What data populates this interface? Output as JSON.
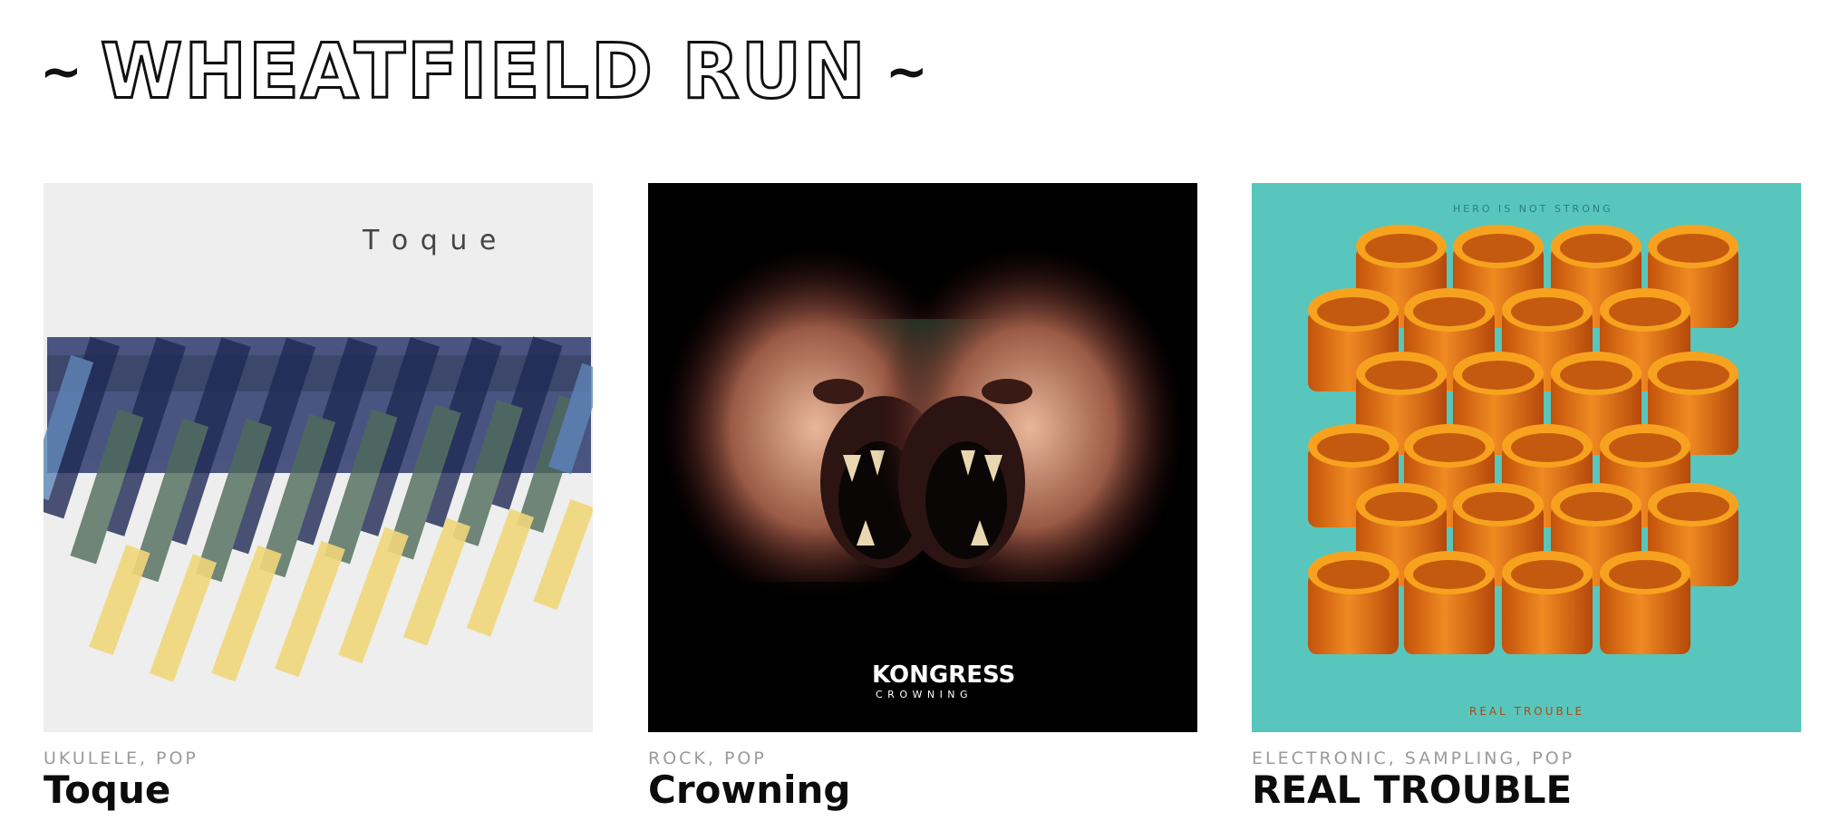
{
  "site": {
    "title": "WHEATFIELD RUN",
    "tilde_left": "~",
    "tilde_right": "~"
  },
  "albums": [
    {
      "title": "Toque",
      "genres": "UKULELE, POP",
      "cover": {
        "text": "T o q u e",
        "bg": "#efefef"
      }
    },
    {
      "title": "Crowning",
      "genres": "ROCK, POP",
      "cover": {
        "band": "KONGRESS",
        "subtitle": "C R O W N I N G",
        "bg": "#000000"
      }
    },
    {
      "title": "REAL TROUBLE",
      "genres": "ELECTRONIC, SAMPLING, POP",
      "cover": {
        "top_text": "HERO IS NOT STRONG",
        "bottom_text": "REAL TROUBLE",
        "bg": "#58c6bd",
        "accent": "#ee7a14"
      }
    }
  ]
}
